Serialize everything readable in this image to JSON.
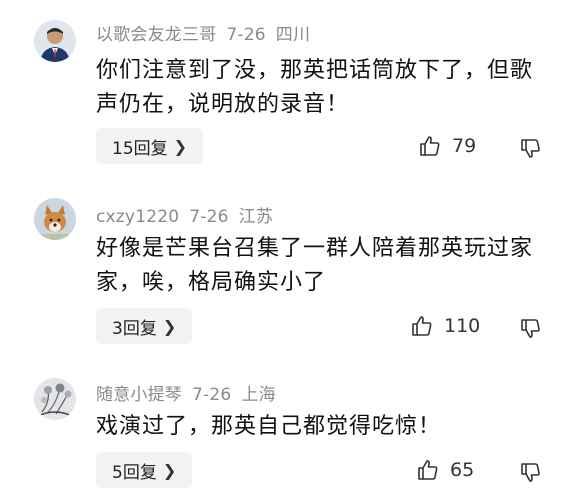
{
  "comments": [
    {
      "username": "以歌会友龙三哥",
      "date": "7-26",
      "location": "四川",
      "text": "你们注意到了没，那英把话筒放下了，但歌声仍在，说明放的录音！",
      "replies_label": "15回复",
      "likes": "79",
      "avatar": "man-in-suit-avatar"
    },
    {
      "username": "cxzy1220",
      "date": "7-26",
      "location": "江苏",
      "text": "好像是芒果台召集了一群人陪着那英玩过家家，唉，格局确实小了",
      "replies_label": "3回复",
      "likes": "110",
      "avatar": "shiba-dog-avatar"
    },
    {
      "username": "随意小提琴",
      "date": "7-26",
      "location": "上海",
      "text": "戏演过了，那英自己都觉得吃惊！",
      "replies_label": "5回复",
      "likes": "65",
      "avatar": "flower-sketch-avatar"
    }
  ],
  "icons": {
    "like": "thumbs-up-icon",
    "dislike": "thumbs-down-icon",
    "chevron": "chevron-right-icon"
  }
}
